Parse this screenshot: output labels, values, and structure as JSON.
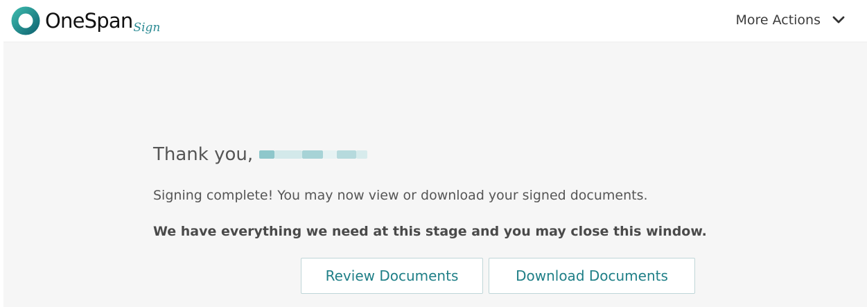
{
  "header": {
    "logo_text": "OneSpan",
    "logo_sign": "Sign",
    "more_actions_label": "More Actions"
  },
  "main": {
    "thanks_prefix": "Thank you,",
    "message_line1": "Signing complete! You may now view or download your signed documents.",
    "message_line2": "We have everything we need at this stage and you may close this window.",
    "review_button": "Review Documents",
    "download_button": "Download Documents"
  },
  "colors": {
    "brand_teal": "#1f7f87",
    "button_border": "#bfd6d8",
    "background": "#f6f6f6"
  }
}
